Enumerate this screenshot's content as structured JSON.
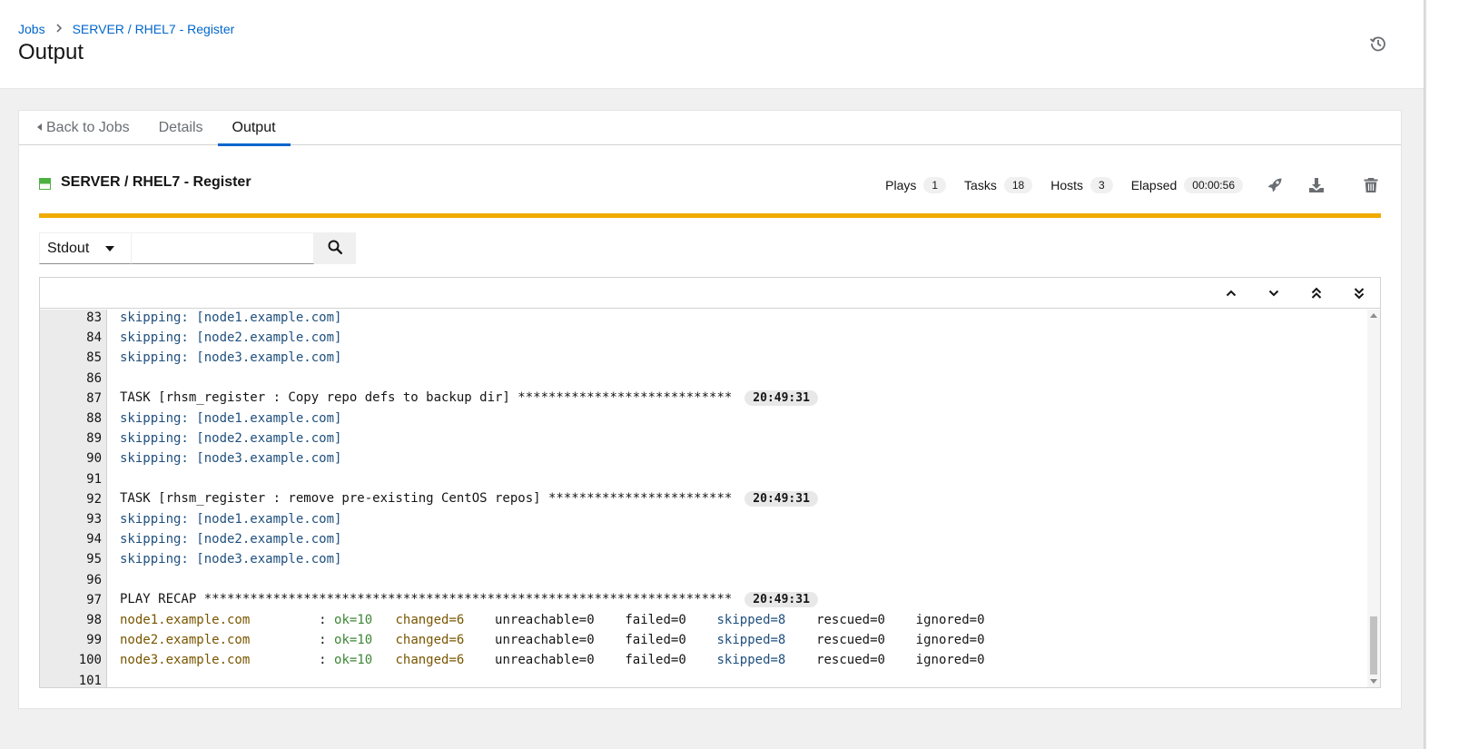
{
  "header": {
    "breadcrumb": [
      {
        "label": "Jobs"
      },
      {
        "label": "SERVER / RHEL7 - Register"
      }
    ],
    "title": "Output",
    "history_icon": "history-icon"
  },
  "tabs": [
    {
      "label": "Back to Jobs"
    },
    {
      "label": "Details"
    },
    {
      "label": "Output"
    }
  ],
  "job": {
    "name": "SERVER / RHEL7 - Register",
    "status_color": "#4cb140",
    "stats": {
      "plays_label": "Plays",
      "plays": "1",
      "tasks_label": "Tasks",
      "tasks": "18",
      "hosts_label": "Hosts",
      "hosts": "3",
      "elapsed_label": "Elapsed",
      "elapsed": "00:00:56"
    },
    "progress_color": "#f0ab00"
  },
  "filter": {
    "selected": "Stdout",
    "search_value": ""
  },
  "output": {
    "lines": [
      {
        "num": "83",
        "text": "skipping: [node1.example.com]",
        "kind": "skip"
      },
      {
        "num": "84",
        "text": "skipping: [node2.example.com]",
        "kind": "skip"
      },
      {
        "num": "85",
        "text": "skipping: [node3.example.com]",
        "kind": "skip"
      },
      {
        "num": "86",
        "text": "",
        "kind": "plain"
      },
      {
        "num": "87",
        "text": "TASK [rhsm_register : Copy repo defs to backup dir] ****************************",
        "kind": "task",
        "time": "20:49:31"
      },
      {
        "num": "88",
        "text": "skipping: [node1.example.com]",
        "kind": "skip"
      },
      {
        "num": "89",
        "text": "skipping: [node2.example.com]",
        "kind": "skip"
      },
      {
        "num": "90",
        "text": "skipping: [node3.example.com]",
        "kind": "skip"
      },
      {
        "num": "91",
        "text": "",
        "kind": "plain"
      },
      {
        "num": "92",
        "text": "TASK [rhsm_register : remove pre-existing CentOS repos] ************************",
        "kind": "task",
        "time": "20:49:31"
      },
      {
        "num": "93",
        "text": "skipping: [node1.example.com]",
        "kind": "skip"
      },
      {
        "num": "94",
        "text": "skipping: [node2.example.com]",
        "kind": "skip"
      },
      {
        "num": "95",
        "text": "skipping: [node3.example.com]",
        "kind": "skip"
      },
      {
        "num": "96",
        "text": "",
        "kind": "plain"
      },
      {
        "num": "97",
        "text": "PLAY RECAP *********************************************************************",
        "kind": "task",
        "time": "20:49:31"
      },
      {
        "num": "98",
        "kind": "recap",
        "host": "node1.example.com         ",
        "colon": ": ",
        "ok": "ok=10",
        "changed": "changed=6",
        "unreachable": "unreachable=0",
        "failed": "failed=0",
        "skipped": "skipped=8",
        "rescued": "rescued=0",
        "ignored": "ignored=0"
      },
      {
        "num": "99",
        "kind": "recap",
        "host": "node2.example.com         ",
        "colon": ": ",
        "ok": "ok=10",
        "changed": "changed=6",
        "unreachable": "unreachable=0",
        "failed": "failed=0",
        "skipped": "skipped=8",
        "rescued": "rescued=0",
        "ignored": "ignored=0"
      },
      {
        "num": "100",
        "kind": "recap",
        "host": "node3.example.com         ",
        "colon": ": ",
        "ok": "ok=10",
        "changed": "changed=6",
        "unreachable": "unreachable=0",
        "failed": "failed=0",
        "skipped": "skipped=8",
        "rescued": "rescued=0",
        "ignored": "ignored=0"
      },
      {
        "num": "101",
        "text": "",
        "kind": "plain"
      }
    ]
  },
  "icons": {
    "launch": "rocket-icon",
    "download": "download-icon",
    "delete": "trash-icon",
    "search": "search-icon",
    "scroll_previous": "angle-up-icon",
    "scroll_next": "angle-down-icon",
    "scroll_first": "angle-double-up-icon",
    "scroll_last": "angle-double-down-icon"
  }
}
